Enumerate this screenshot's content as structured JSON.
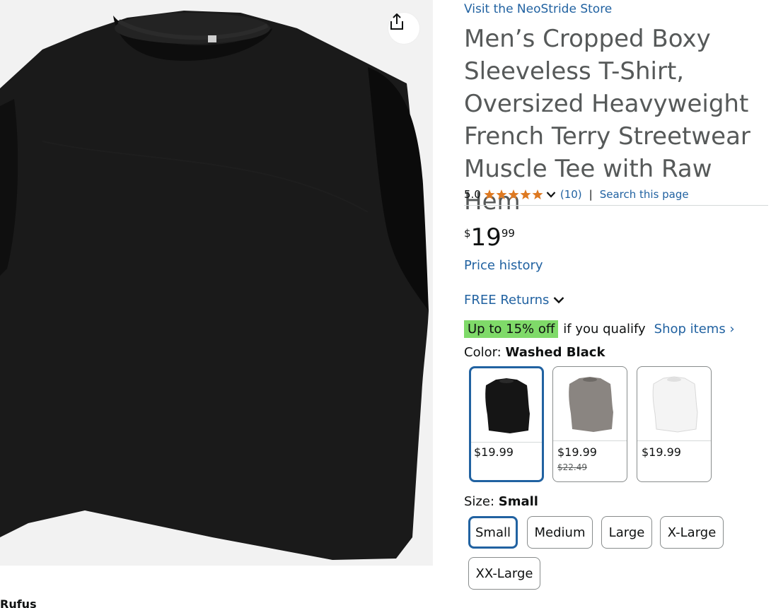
{
  "product": {
    "store_link": "Visit the NeoStride Store",
    "title": "Men’s Cropped Boxy Sleeveless T-Shirt, Oversized Heavyweight French Terry Streetwear Muscle Tee with Raw Hem",
    "rating": "5.0",
    "rating_count": "(10)",
    "search_link": "Search this page",
    "separator": "|",
    "price_symbol": "$",
    "price_whole": "19",
    "price_fraction": "99",
    "price_history": "Price history",
    "free_returns": "FREE Returns",
    "promo_badge": "Up to 15% off",
    "promo_text": "if you qualify",
    "shop_items": "Shop items ›"
  },
  "color": {
    "label": "Color:",
    "selected": "Washed Black",
    "swatches": [
      {
        "name": "Washed Black",
        "price": "$19.99",
        "list_price": "",
        "color": "#151515"
      },
      {
        "name": "Gray",
        "price": "$19.99",
        "list_price": "$22.49",
        "color": "#8a8581"
      },
      {
        "name": "White",
        "price": "$19.99",
        "list_price": "",
        "color": "#f1f1f1"
      }
    ]
  },
  "size": {
    "label": "Size:",
    "selected": "Small",
    "options": [
      "Small",
      "Medium",
      "Large",
      "X-Large",
      "XX-Large"
    ]
  },
  "rufus": "Rufus",
  "colors": {
    "link": "#2162a1",
    "star": "#de7921",
    "promo": "#7fda69",
    "selected_border": "#2162a1"
  }
}
